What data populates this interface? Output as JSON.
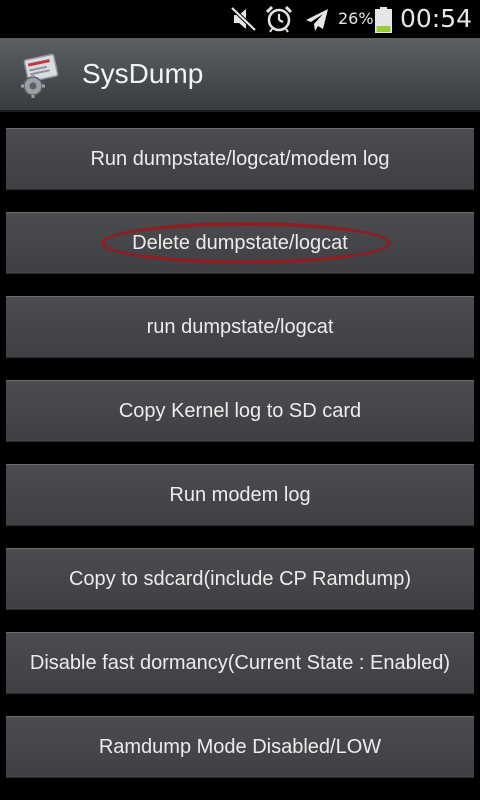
{
  "status_bar": {
    "icons": [
      "mute-icon",
      "alarm-icon",
      "airplane-mode-icon"
    ],
    "battery_percent": "26%",
    "battery_level": 0.26,
    "time": "00:54"
  },
  "app": {
    "title": "SysDump",
    "icon": "sysdump-app-icon"
  },
  "buttons": [
    {
      "label": "Run dumpstate/logcat/modem log"
    },
    {
      "label": "Delete dumpstate/logcat"
    },
    {
      "label": "run dumpstate/logcat"
    },
    {
      "label": "Copy Kernel log to SD card"
    },
    {
      "label": "Run modem log"
    },
    {
      "label": "Copy to sdcard(include CP Ramdump)"
    },
    {
      "label": "Disable fast dormancy(Current State : Enabled)"
    },
    {
      "label": "Ramdump Mode Disabled/LOW"
    }
  ],
  "colors": {
    "annotation_ellipse": "#8b1f24",
    "battery_fill": "#9acd32"
  }
}
